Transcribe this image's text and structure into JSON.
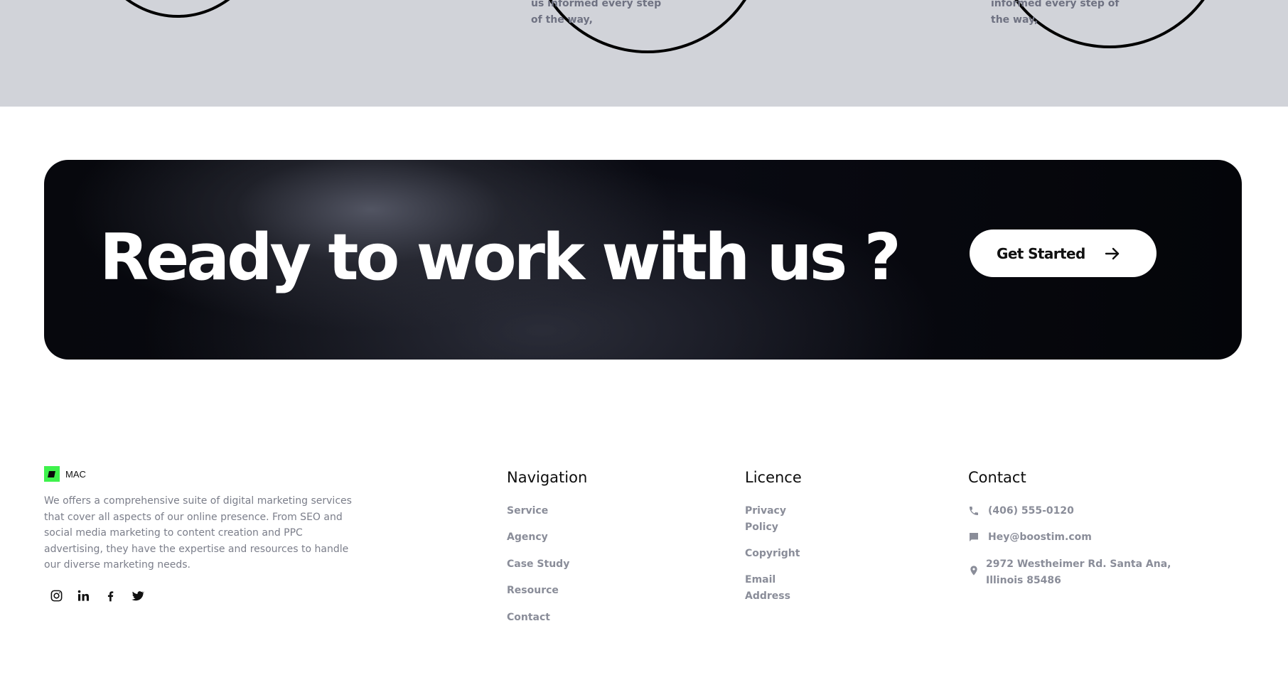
{
  "process_steps": {
    "step2_text": "us informed every step of the way,",
    "step3_text": "informed every step of the way,"
  },
  "cta": {
    "title": "Ready to work with us ?",
    "button_label": "Get Started"
  },
  "footer": {
    "brand_name": "MAC",
    "description": "We offers a comprehensive suite of digital marketing services that cover all aspects of our online presence. From SEO and social media marketing to content creation and PPC advertising, they have the expertise and resources to handle our diverse marketing needs.",
    "socials": [
      "instagram-icon",
      "linkedin-icon",
      "facebook-icon",
      "twitter-icon"
    ],
    "navigation": {
      "heading": "Navigation",
      "links": [
        "Service",
        "Agency",
        "Case Study",
        "Resource",
        "Contact"
      ]
    },
    "licence": {
      "heading": "Licence",
      "links": [
        "Privacy Policy",
        "Copyright",
        "Email Address"
      ]
    },
    "contact": {
      "heading": "Contact",
      "phone": "(406) 555-0120",
      "email": "Hey@boostim.com",
      "address": "2972 Westheimer Rd. Santa Ana, Illinois 85486"
    }
  },
  "colors": {
    "top_band": "#d1d3d9",
    "logo_accent": "#3ef24c",
    "muted_text": "#8a8d99"
  }
}
